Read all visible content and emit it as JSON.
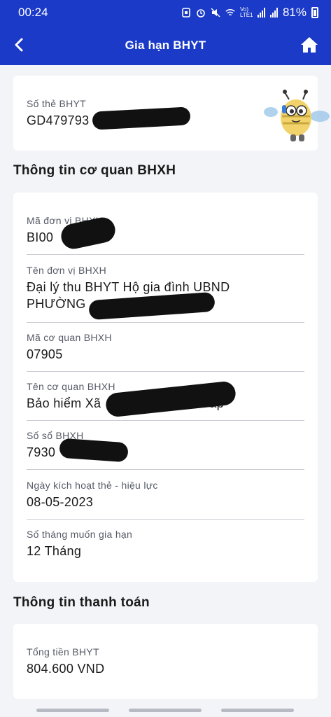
{
  "status_bar": {
    "time": "00:24",
    "network_label": "Vo) LTE1",
    "battery": "81%"
  },
  "app_bar": {
    "title": "Gia hạn BHYT",
    "back_icon": "chevron-left-icon",
    "home_icon": "home-icon"
  },
  "card_number": {
    "label": "Số thẻ BHYT",
    "value": "GD479793"
  },
  "agency_section": {
    "title": "Thông tin cơ quan BHXH",
    "fields": [
      {
        "label": "Mã  đơn vị BHXH",
        "value": "BI00"
      },
      {
        "label": "Tên đơn vị BHXH",
        "value": "Đại lý thu BHYT Hộ gia đình UBND",
        "value2": "PHƯỜNG"
      },
      {
        "label": "Mã cơ quan BHXH",
        "value": "07905"
      },
      {
        "label": "Tên cơ quan BHXH",
        "value": "Bảo hiểm Xã",
        "value_tail": "Vấp"
      },
      {
        "label": "Số sổ BHXH",
        "value": "7930"
      },
      {
        "label": "Ngày kích hoạt thẻ - hiệu lực",
        "value": "08-05-2023"
      },
      {
        "label": "Số tháng muốn gia hạn",
        "value": "12 Tháng"
      }
    ]
  },
  "payment_section": {
    "title": "Thông tin thanh toán",
    "total_label": "Tổng tiền BHYT",
    "total_value": "804.600 VND"
  },
  "colors": {
    "header_blue": "#1a3ac7",
    "background": "#f3f4f8",
    "card": "#ffffff"
  }
}
